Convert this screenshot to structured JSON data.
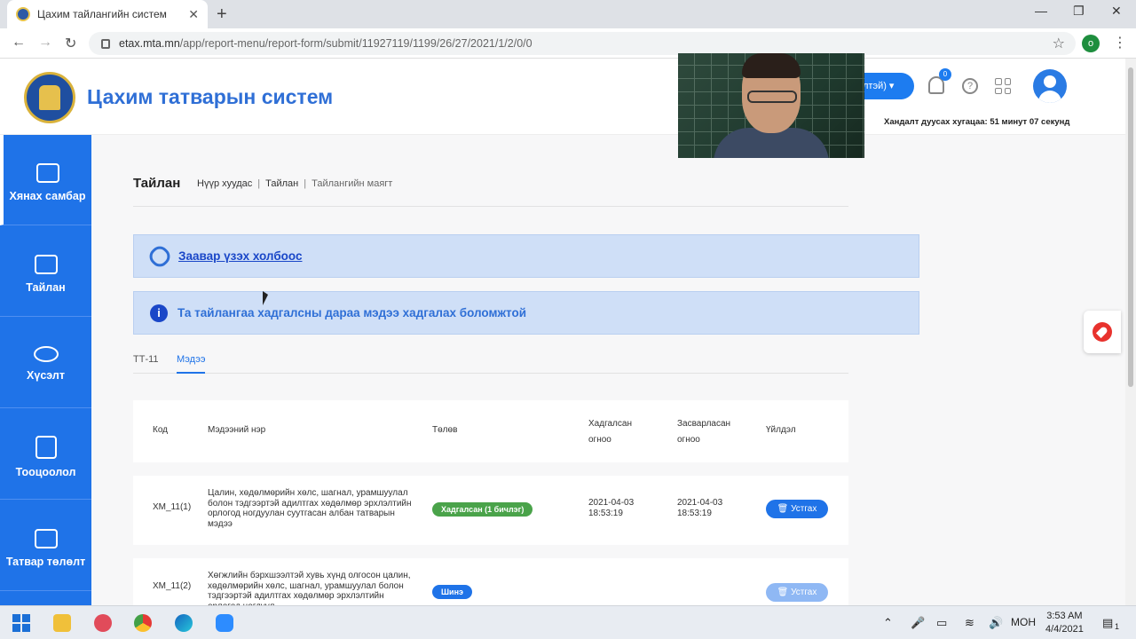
{
  "browser": {
    "tab_title": "Цахим тайлангийн систем",
    "close_tab": "✕",
    "new_tab": "+",
    "url_host": "etax.mta.mn",
    "url_path": "/app/report-menu/report-form/submit/11927119/1199/26/27/2021/1/2/0/0",
    "profile_letter": "o"
  },
  "header": {
    "brand": "Цахим татварын систем",
    "lang_button": "лтэй) ▾",
    "notification_count": "0",
    "session_text": "Хандалт дуусах хугацаа: 51 минут 07 секунд"
  },
  "sidebar": {
    "items": [
      {
        "label": "Хянах самбар"
      },
      {
        "label": "Тайлан"
      },
      {
        "label": "Хүсэлт"
      },
      {
        "label": "Тооцоолол"
      },
      {
        "label": "Татвар төлөлт"
      }
    ]
  },
  "main": {
    "title": "Тайлан",
    "breadcrumb": [
      "Нүүр хуудас",
      "Тайлан",
      "Тайлангийн маягт"
    ],
    "guide_link": "Заавар үзэх холбоос",
    "info_message": "Та тайлангаа хадгалсны дараа мэдээ хадгалах боломжтой",
    "tabs": [
      "ТТ-11",
      "Мэдээ"
    ],
    "table": {
      "headers": [
        "Код",
        "Мэдээний нэр",
        "Төлөв",
        "Хадгалсан огноо",
        "Засварласан огноо",
        "Үйлдэл"
      ],
      "rows": [
        {
          "code": "ХМ_11(1)",
          "name": "Цалин, хөдөлмөрийн хөлс, шагнал, урамшуулал болон тэдгээртэй адилтгах хөдөлмөр эрхлэлтийн орлогод ногдуулан суутгасан албан татварын мэдээ",
          "status": "Хадгалсан (1 бичлэг)",
          "saved_date": "2021-04-03 18:53:19",
          "edited_date": "2021-04-03 18:53:19",
          "action": "🗑 Устгах"
        },
        {
          "code": "ХМ_11(2)",
          "name": "Хөгжлийн бэрхшээлтэй хувь хүнд олгосон цалин, хөдөлмөрийн хөлс, шагнал, урамшуулал болон тэдгээртэй адилтгах хөдөлмөр эрхлэлтийн орлогод ногдуул...",
          "status": "Шинэ",
          "saved_date": "",
          "edited_date": "",
          "action": "🗑 Устгах"
        }
      ]
    }
  },
  "taskbar": {
    "lang": "MOH",
    "time": "3:53 AM",
    "date": "4/4/2021",
    "notif_count": "1"
  }
}
